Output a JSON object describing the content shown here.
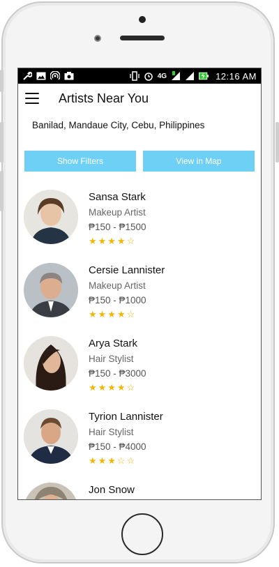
{
  "status_bar": {
    "time": "12:16 AM",
    "network": "4G",
    "icons": [
      "wrench-icon",
      "image-icon",
      "hotspot-icon",
      "camera-icon",
      "vibrate-icon",
      "alarm-icon",
      "signal-icon",
      "signal-icon",
      "battery-charging-icon"
    ]
  },
  "header": {
    "title": "Artists Near You"
  },
  "location": "Banilad, Mandaue City, Cebu, Philippines",
  "buttons": {
    "filters": "Show Filters",
    "map": "View in Map"
  },
  "colors": {
    "accent": "#6fd0f6",
    "star": "#f2b705"
  },
  "artists": [
    {
      "name": "Sansa Stark",
      "role": "Makeup Artist",
      "price": "₱150 - ₱1500",
      "stars": "★★★★☆",
      "rating": 4
    },
    {
      "name": "Cersie Lannister",
      "role": "Makeup Artist",
      "price": "₱150 - ₱1000",
      "stars": "★★★★☆",
      "rating": 4
    },
    {
      "name": "Arya Stark",
      "role": "Hair Stylist",
      "price": "₱150 - ₱3000",
      "stars": "★★★★☆",
      "rating": 4
    },
    {
      "name": "Tyrion Lannister",
      "role": "Hair Stylist",
      "price": "₱150 - ₱4000",
      "stars": "★★★☆☆",
      "rating": 3
    },
    {
      "name": "Jon Snow",
      "role": "",
      "price": "",
      "stars": "",
      "rating": 0
    }
  ]
}
